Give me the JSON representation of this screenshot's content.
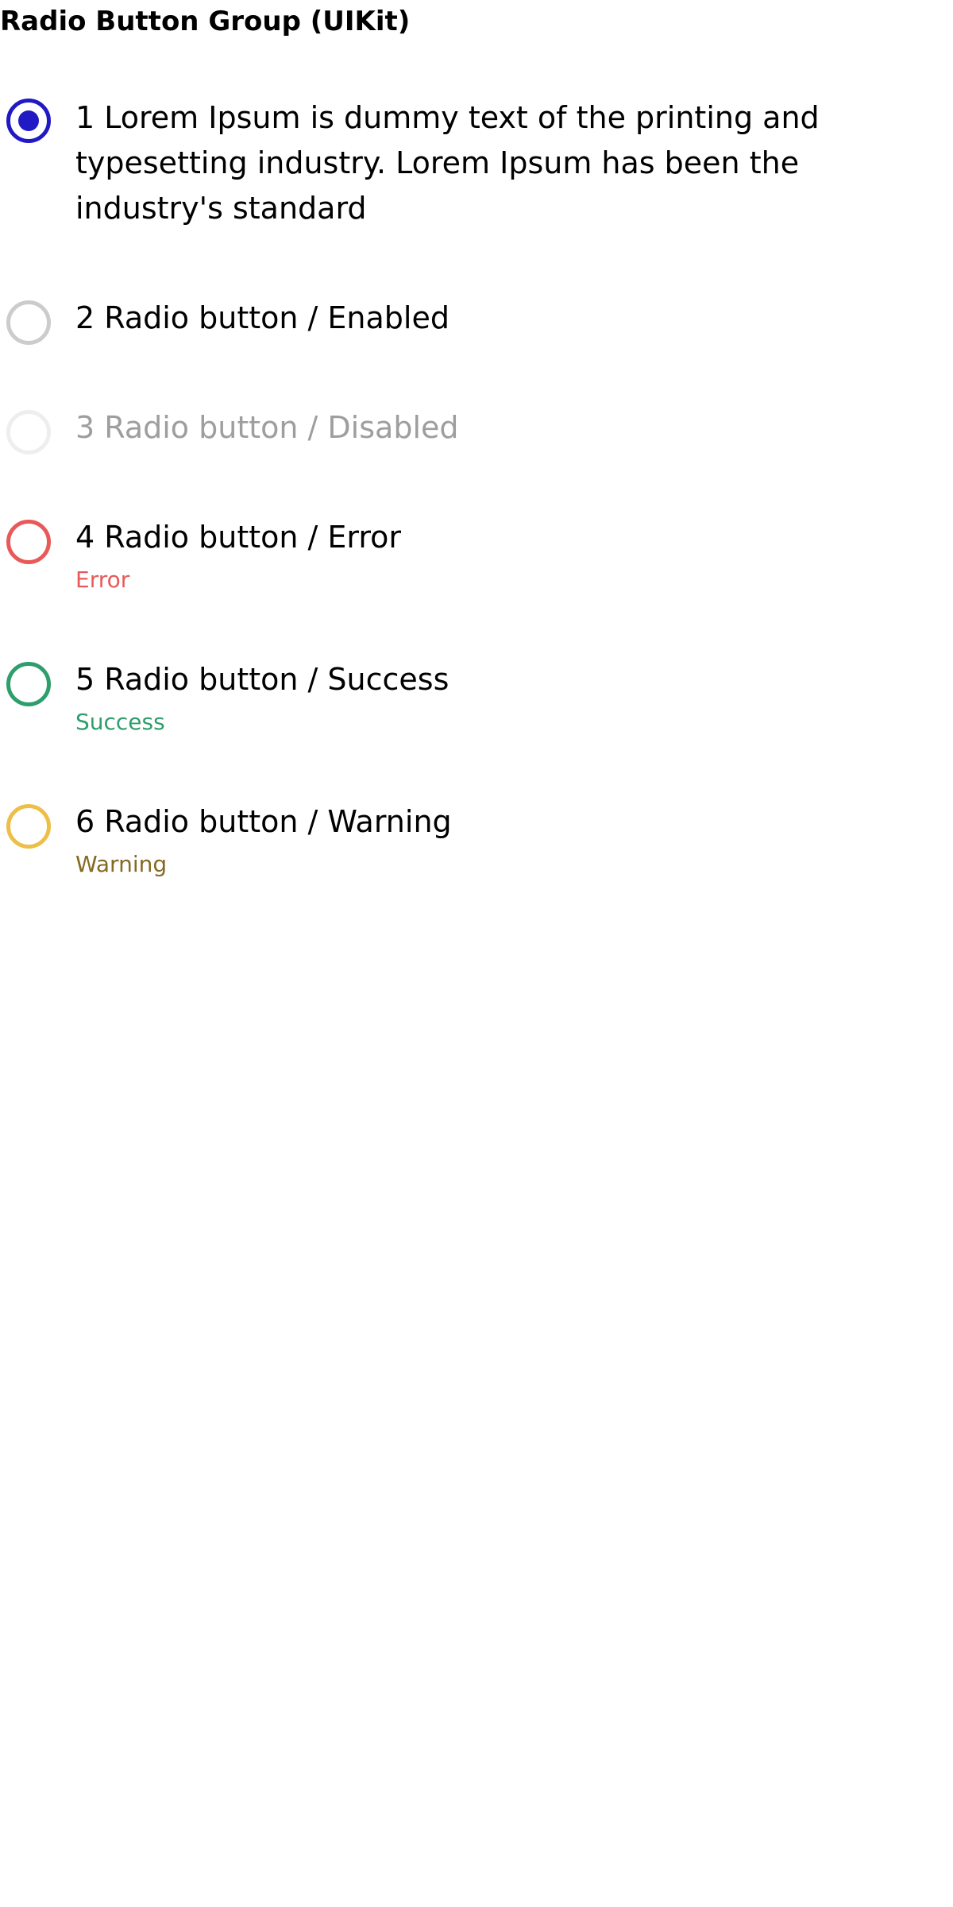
{
  "page": {
    "title": "Radio Button Group (UIKit)"
  },
  "colors": {
    "selected": "#2019C4",
    "enabled_border": "#CCCCCC",
    "disabled_border": "#EEEEEE",
    "disabled_text": "#9E9E9E",
    "error": "#E85A5A",
    "success": "#2E9E6C",
    "warning_border": "#EDBF47",
    "warning_text": "#856A23",
    "text": "#000000"
  },
  "radio_group": {
    "items": [
      {
        "label": "1 Lorem Ipsum is dummy text of the printing and typesetting industry. Lorem Ipsum has been the industry's standard",
        "state": "selected",
        "checked": true
      },
      {
        "label": "2 Radio button / Enabled",
        "state": "enabled",
        "checked": false
      },
      {
        "label": "3 Radio button / Disabled",
        "state": "disabled",
        "checked": false
      },
      {
        "label": "4 Radio button / Error",
        "state": "error",
        "checked": false,
        "helper": "Error"
      },
      {
        "label": "5 Radio button / Success",
        "state": "success",
        "checked": false,
        "helper": "Success"
      },
      {
        "label": "6 Radio button / Warning",
        "state": "warning",
        "checked": false,
        "helper": "Warning"
      }
    ]
  }
}
